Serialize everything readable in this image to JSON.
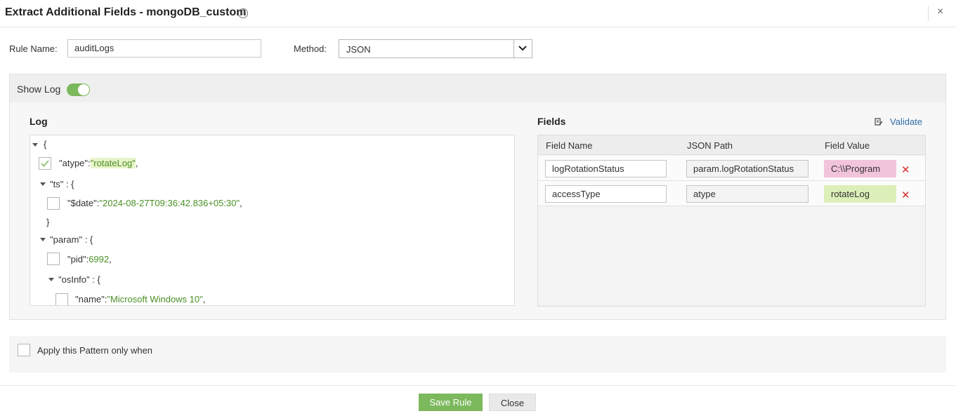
{
  "header": {
    "title": "Extract Additional Fields - mongoDB_custom",
    "help_icon": "?",
    "close_icon": "×"
  },
  "form": {
    "rule_name_label": "Rule Name:",
    "rule_name_value": "auditLogs",
    "method_label": "Method:",
    "method_value": "JSON"
  },
  "panel": {
    "show_log_label": "Show Log",
    "show_log_enabled": true,
    "log_title": "Log",
    "fields_title": "Fields",
    "validate_label": "Validate"
  },
  "log": {
    "open_brace": "{",
    "atype_key": "\"atype\":",
    "atype_val": "\"rotateLog\"",
    "atype_comma": ",",
    "atype_checked": true,
    "ts_key": "\"ts\" : {",
    "date_key": "\"$date\":",
    "date_val": "\"2024-08-27T09:36:42.836+05:30\"",
    "date_comma": ",",
    "ts_close": "}",
    "param_key": "\"param\" : {",
    "pid_key": "\"pid\":",
    "pid_val": "6992",
    "pid_comma": ",",
    "osinfo_key": "\"osInfo\" : {",
    "name_key": "\"name\":",
    "name_val": "\"Microsoft Windows 10\"",
    "name_comma": ","
  },
  "fields": {
    "columns": [
      "Field Name",
      "JSON Path",
      "Field Value"
    ],
    "rows": [
      {
        "name": "logRotationStatus",
        "path": "param.logRotationStatus",
        "value": "C:\\\\Program",
        "value_color": "#f2c4dc"
      },
      {
        "name": "accessType",
        "path": "atype",
        "value": "rotateLog",
        "value_color": "#dcefb8"
      }
    ],
    "delete_icon": "✕"
  },
  "condition": {
    "label": "Apply this Pattern only when",
    "checked": false
  },
  "footer": {
    "save_label": "Save Rule",
    "close_label": "Close"
  },
  "colors": {
    "accent_green": "#7cb85c",
    "json_value_green": "#4a8f25",
    "link_blue": "#2f6ea6",
    "delete_red": "#d9302c"
  }
}
